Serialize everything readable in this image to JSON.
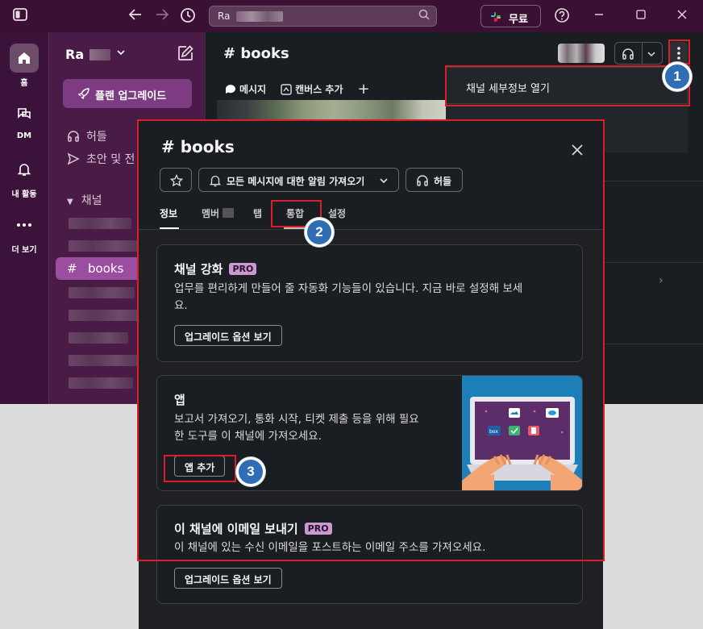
{
  "titlebar": {
    "search_value": "Ra",
    "upgrade_plan_label": "무료",
    "icons": [
      "sidebar-toggle-icon",
      "back-arrow-icon",
      "forward-arrow-icon",
      "history-icon",
      "search-icon",
      "slack-logo-icon",
      "help-icon",
      "minimize-icon",
      "maximize-icon",
      "close-icon"
    ]
  },
  "rail": {
    "items": [
      {
        "label": "홈",
        "icon": "home-icon"
      },
      {
        "label": "DM",
        "icon": "dm-icon"
      },
      {
        "label": "내 활동",
        "icon": "bell-icon"
      },
      {
        "label": "더 보기",
        "icon": "more-icon"
      }
    ]
  },
  "sidebar": {
    "workspace_name": "Ra",
    "upgrade_button": "플랜 업그레이드",
    "huddles": "허들",
    "drafts": "초안 및 전",
    "channels_section": "채널",
    "active_channel": "books"
  },
  "main": {
    "channel_title": "books",
    "tabs": [
      "메시지",
      "캔버스 추가"
    ]
  },
  "context_menu": {
    "open_details": "채널 세부정보 열기"
  },
  "modal": {
    "title": "books",
    "notif_button": "모든 메시지에 대한 알림 가져오기",
    "huddle_button": "허들",
    "tabs": [
      "정보",
      "멤버",
      "탭",
      "통합",
      "설정"
    ],
    "cards": {
      "enhance": {
        "title": "채널 강화",
        "badge": "PRO",
        "desc_line1": "업무를 편리하게 만들어 줄 자동화 기능들이 있습니다. 지금 바로 설정해 보세",
        "desc_line2": "요.",
        "button": "업그레이드 옵션 보기"
      },
      "apps": {
        "title": "앱",
        "desc_line1": "보고서 가져오기, 통화 시작, 티켓 제출 등을 위해 필요",
        "desc_line2": "한 도구를 이 채널에 가져오세요.",
        "button": "앱 추가"
      },
      "email": {
        "title": "이 채널에 이메일 보내기",
        "badge": "PRO",
        "desc": "이 채널에 있는 수신 이메일을 포스트하는 이메일 주소를 가져오세요.",
        "button": "업그레이드 옵션 보기"
      }
    }
  },
  "annotations": {
    "step1": "1",
    "step2": "2",
    "step3": "3"
  },
  "colors": {
    "title_bar": "#3a1034",
    "sidebar": "#4a1b46",
    "highlight_red": "#d9202a",
    "badge_blue": "#2f6db5",
    "active_channel": "#9b4ea0"
  }
}
